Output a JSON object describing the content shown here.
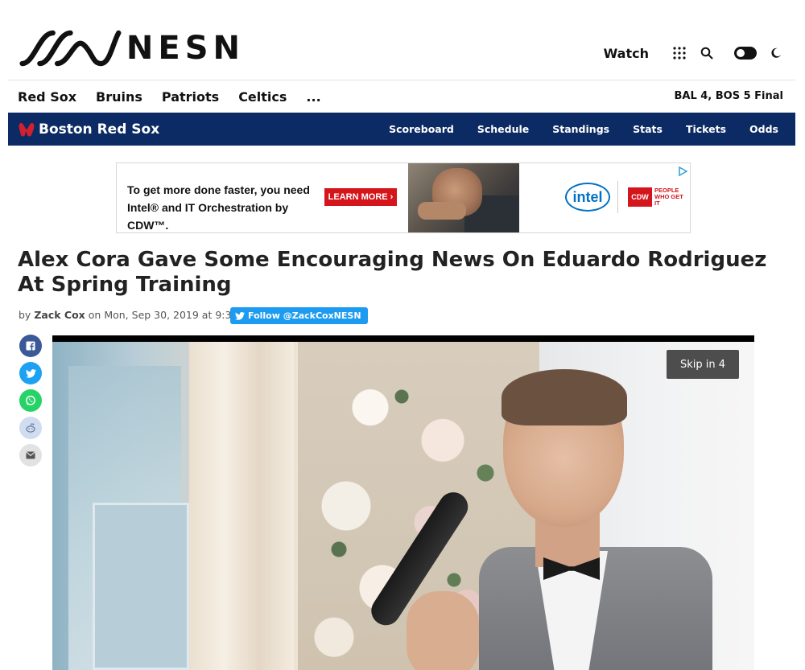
{
  "header": {
    "logo_text": "NESN",
    "watch_label": "Watch"
  },
  "sport_nav": {
    "items": [
      "Red Sox",
      "Bruins",
      "Patriots",
      "Celtics",
      "..."
    ],
    "score": "BAL 4, BOS 5 Final"
  },
  "team_bar": {
    "team_name": "Boston Red Sox",
    "links": [
      "Scoreboard",
      "Schedule",
      "Standings",
      "Stats",
      "Tickets",
      "Odds"
    ],
    "bg_color": "#0c2a63"
  },
  "ad": {
    "line1": "To get more done faster, you need",
    "line2": "Intel® and IT Orchestration by CDW™.",
    "cta": "LEARN MORE ›",
    "intel_text": "intel",
    "cdw_text": "CDW",
    "cdw_tagline": "PEOPLE WHO GET IT"
  },
  "article": {
    "headline": "Alex Cora Gave Some Encouraging News On Eduardo Rodriguez At Spring Training",
    "by": "by",
    "author": "Zack Cox",
    "on": "on",
    "date": "Mon, Sep 30, 2019 at 9:31AM",
    "follow_label": "Follow @ZackCoxNESN"
  },
  "share": {
    "icons": [
      "facebook-icon",
      "twitter-icon",
      "whatsapp-icon",
      "reddit-icon",
      "email-icon"
    ]
  },
  "video": {
    "skip_label": "Skip in 4"
  }
}
